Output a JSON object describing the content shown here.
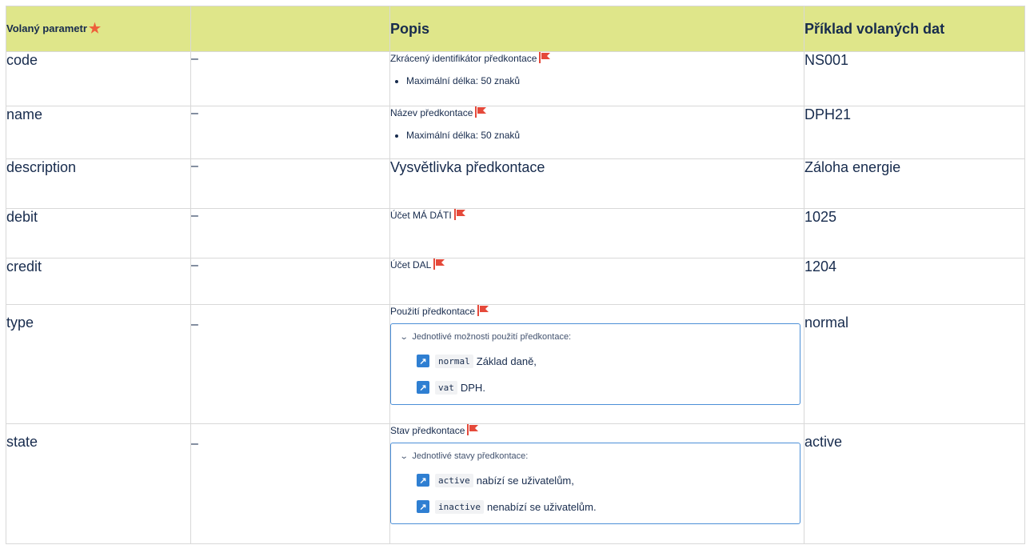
{
  "header": {
    "param": "Volaný parametr",
    "empty": "",
    "popis": "Popis",
    "example": "Příklad volaných dat"
  },
  "rows": [
    {
      "name": "code",
      "dash": "–",
      "desc": "Zkrácený identifikátor předkontace",
      "bullet": "Maximální délka: 50 znaků",
      "example": "NS001"
    },
    {
      "name": "name",
      "dash": "–",
      "desc": "Název předkontace",
      "bullet": "Maximální délka: 50 znaků",
      "example": "DPH21"
    },
    {
      "name": "description",
      "dash": "–",
      "desc": "Vysvětlivka předkontace",
      "example": "Záloha energie"
    },
    {
      "name": "debit",
      "dash": "–",
      "desc": "Účet MÁ DÁTI",
      "example": "1025"
    },
    {
      "name": "credit",
      "dash": "–",
      "desc": "Účet DAL",
      "example": "1204"
    },
    {
      "name": "type",
      "dash": "–",
      "desc": "Použití předkontace",
      "expand_title": "Jednotlivé možnosti použití předkontace:",
      "options": [
        {
          "code": "normal",
          "text": "Základ daně,"
        },
        {
          "code": "vat",
          "text": "DPH."
        }
      ],
      "example": "normal"
    },
    {
      "name": "state",
      "dash": "–",
      "desc": "Stav předkontace",
      "expand_title": "Jednotlivé stavy předkontace:",
      "options": [
        {
          "code": "active",
          "text": "nabízí se uživatelům,"
        },
        {
          "code": "inactive",
          "text": "nenabízí se uživatelům."
        }
      ],
      "example": "active"
    }
  ],
  "icons": {
    "required": "star-icon",
    "flag": "flag-icon",
    "chevron": "chevron-down-icon",
    "link": "arrow-link-icon"
  },
  "colors": {
    "header_bg": "#dfe68a",
    "star": "#ee5f3a",
    "flag": "#e5493a",
    "link_icon": "#2f7fd2",
    "expand_border": "#4c8fd7"
  }
}
